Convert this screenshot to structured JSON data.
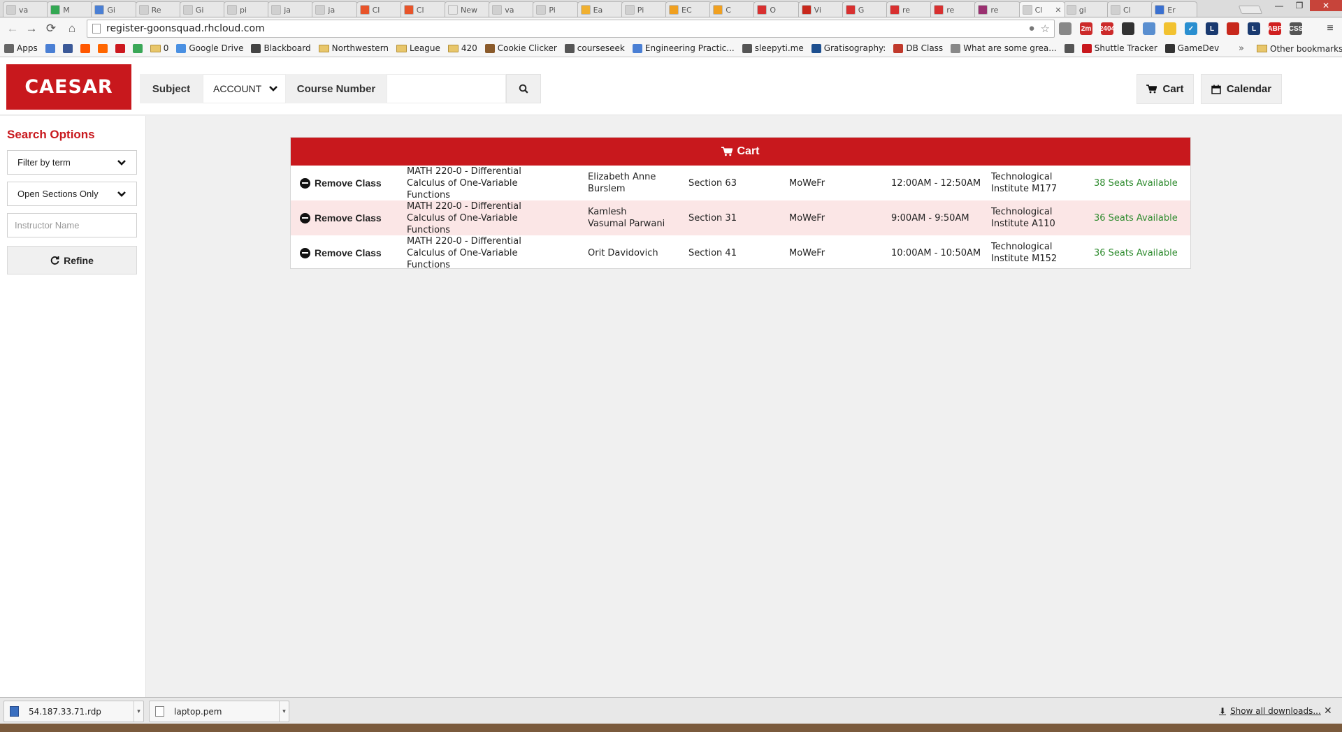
{
  "browser": {
    "tabs": [
      {
        "label": "va",
        "color": "#d0d0d0"
      },
      {
        "label": "M",
        "color": "#34a853"
      },
      {
        "label": "Gi",
        "color": "#4a7fd4"
      },
      {
        "label": "Re",
        "color": "#d0d0d0"
      },
      {
        "label": "Gi",
        "color": "#d0d0d0"
      },
      {
        "label": "pi",
        "color": "#d0d0d0"
      },
      {
        "label": "ja",
        "color": "#d0d0d0"
      },
      {
        "label": "ja",
        "color": "#d0d0d0"
      },
      {
        "label": "Cl",
        "color": "#e8542a"
      },
      {
        "label": "Cl",
        "color": "#e8542a"
      },
      {
        "label": "New",
        "color": "#e7e7e7"
      },
      {
        "label": "va",
        "color": "#d0d0d0"
      },
      {
        "label": "Pi",
        "color": "#d0d0d0"
      },
      {
        "label": "Ea",
        "color": "#f0b030"
      },
      {
        "label": "Pi",
        "color": "#d0d0d0"
      },
      {
        "label": "EC",
        "color": "#f0a020"
      },
      {
        "label": "C",
        "color": "#f0a020"
      },
      {
        "label": "O",
        "color": "#d83030"
      },
      {
        "label": "Vi",
        "color": "#c8281c"
      },
      {
        "label": "G",
        "color": "#d83030"
      },
      {
        "label": "re",
        "color": "#d83030"
      },
      {
        "label": "re",
        "color": "#d83030"
      },
      {
        "label": "re",
        "color": "#9a3070"
      },
      {
        "label": "Cl",
        "color": "#d0d0d0",
        "close": "✕"
      },
      {
        "label": "gi",
        "color": "#d0d0d0"
      },
      {
        "label": "Cl",
        "color": "#d0d0d0"
      },
      {
        "label": "Er",
        "color": "#3a70d0"
      }
    ],
    "url": "register-goonsquad.rhcloud.com",
    "bookmarks": [
      {
        "label": "Apps",
        "icon": "apps-icon",
        "color": "#666"
      },
      {
        "label": "",
        "icon": "calendar-icon",
        "color": "#4a7fd4"
      },
      {
        "label": "",
        "icon": "facebook-icon",
        "color": "#3b5998"
      },
      {
        "label": "",
        "icon": "reddit-icon",
        "color": "#ff5700"
      },
      {
        "label": "",
        "icon": "hackernews-icon",
        "color": "#ff6600"
      },
      {
        "label": "",
        "icon": "youtube-icon",
        "color": "#cc181e"
      },
      {
        "label": "",
        "icon": "play-icon",
        "color": "#3aa757"
      },
      {
        "label": "0",
        "icon": "folder-icon",
        "color": "#e8c66a"
      },
      {
        "label": "Google Drive",
        "icon": "drive-icon",
        "color": "#4a90e2"
      },
      {
        "label": "Blackboard",
        "icon": "blackboard-icon",
        "color": "#444"
      },
      {
        "label": "Northwestern",
        "icon": "folder-icon",
        "color": "#e8c66a"
      },
      {
        "label": "League",
        "icon": "folder-icon",
        "color": "#e8c66a"
      },
      {
        "label": "420",
        "icon": "folder-icon",
        "color": "#e8c66a"
      },
      {
        "label": "Cookie Clicker",
        "icon": "cookie-icon",
        "color": "#8a5a2a"
      },
      {
        "label": "courseseek",
        "icon": "courseseek-icon",
        "color": "#555"
      },
      {
        "label": "Engineering Practic...",
        "icon": "google-icon",
        "color": "#4a7fd4"
      },
      {
        "label": "sleepyti.me",
        "icon": "sleep-icon",
        "color": "#555"
      },
      {
        "label": "Gratisography:",
        "icon": "gratisography-icon",
        "color": "#1d4f8f"
      },
      {
        "label": "DB Class",
        "icon": "db-icon",
        "color": "#c0392b"
      },
      {
        "label": "What are some grea...",
        "icon": "quora-icon",
        "color": "#888"
      },
      {
        "label": "",
        "icon": "clock-icon",
        "color": "#555"
      },
      {
        "label": "Shuttle Tracker",
        "icon": "shuttle-icon",
        "color": "#c8181d"
      },
      {
        "label": "GameDev",
        "icon": "gamedev-icon",
        "color": "#333"
      }
    ],
    "bookmarks_more": "»",
    "other_bookmarks": "Other bookmarks",
    "extensions": [
      {
        "icon": "pencil-icon",
        "color": "#888",
        "text": ""
      },
      {
        "icon": "timer-icon",
        "color": "#cc2a2a",
        "text": "2m"
      },
      {
        "icon": "gmail-icon",
        "color": "#cc2a2a",
        "text": "2404"
      },
      {
        "icon": "link-icon",
        "color": "#333",
        "text": ""
      },
      {
        "icon": "window-icon",
        "color": "#5a8fd0",
        "text": ""
      },
      {
        "icon": "note-icon",
        "color": "#f2c230",
        "text": ""
      },
      {
        "icon": "check-icon",
        "color": "#2a8fd0",
        "text": "✓"
      },
      {
        "icon": "league-icon",
        "color": "#1a3a70",
        "text": "L"
      },
      {
        "icon": "bookmark-icon",
        "color": "#c8281c",
        "text": ""
      },
      {
        "icon": "league-icon",
        "color": "#1a3a70",
        "text": "L"
      },
      {
        "icon": "adblock-icon",
        "color": "#d02020",
        "text": "ABP"
      },
      {
        "icon": "css-icon",
        "color": "#555",
        "text": "CSS"
      }
    ]
  },
  "app": {
    "logo": "CAESAR",
    "search": {
      "subject_label": "Subject",
      "subject_value": "ACCOUNT",
      "course_label": "Course Number",
      "course_value": ""
    },
    "nav": {
      "cart_label": "Cart",
      "calendar_label": "Calendar"
    }
  },
  "sidebar": {
    "title": "Search Options",
    "term_filter": "Filter by term",
    "sections_filter": "Open Sections Only",
    "instructor_placeholder": "Instructor Name",
    "refine_label": "Refine"
  },
  "cart": {
    "title": "Cart",
    "rows": [
      {
        "action": "Remove Class",
        "course": "MATH 220-0 - Differential Calculus of One-Variable Functions",
        "instructor": "Elizabeth Anne Burslem",
        "section": "Section 63",
        "days": "MoWeFr",
        "time": "12:00AM - 12:50AM",
        "location": "Technological Institute M177",
        "seats": "38 Seats Available"
      },
      {
        "action": "Remove Class",
        "course": "MATH 220-0 - Differential Calculus of One-Variable Functions",
        "instructor": "Kamlesh Vasumal Parwani",
        "section": "Section 31",
        "days": "MoWeFr",
        "time": "9:00AM - 9:50AM",
        "location": "Technological Institute A110",
        "seats": "36 Seats Available"
      },
      {
        "action": "Remove Class",
        "course": "MATH 220-0 - Differential Calculus of One-Variable Functions",
        "instructor": "Orit Davidovich",
        "section": "Section 41",
        "days": "MoWeFr",
        "time": "10:00AM - 10:50AM",
        "location": "Technological Institute M152",
        "seats": "36 Seats Available"
      }
    ]
  },
  "downloads": {
    "items": [
      {
        "name": "54.187.33.71.rdp"
      },
      {
        "name": "laptop.pem"
      }
    ],
    "show_all": "Show all downloads..."
  },
  "colors": {
    "brand": "#c8181d",
    "seats": "#2e8b2e",
    "alt_row": "#fbe6e6"
  }
}
